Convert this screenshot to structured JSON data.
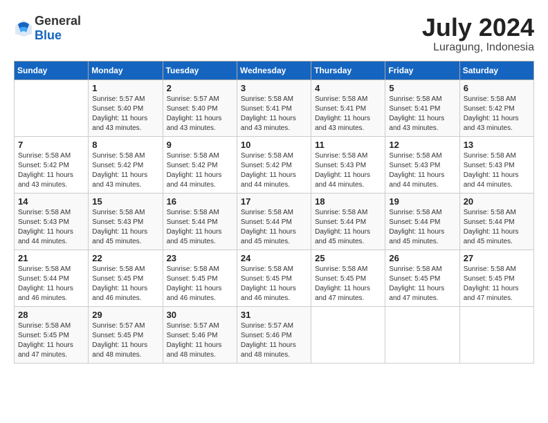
{
  "header": {
    "logo_general": "General",
    "logo_blue": "Blue",
    "month_year": "July 2024",
    "location": "Luragung, Indonesia"
  },
  "weekdays": [
    "Sunday",
    "Monday",
    "Tuesday",
    "Wednesday",
    "Thursday",
    "Friday",
    "Saturday"
  ],
  "weeks": [
    [
      {
        "day": "",
        "info": ""
      },
      {
        "day": "1",
        "info": "Sunrise: 5:57 AM\nSunset: 5:40 PM\nDaylight: 11 hours\nand 43 minutes."
      },
      {
        "day": "2",
        "info": "Sunrise: 5:57 AM\nSunset: 5:40 PM\nDaylight: 11 hours\nand 43 minutes."
      },
      {
        "day": "3",
        "info": "Sunrise: 5:58 AM\nSunset: 5:41 PM\nDaylight: 11 hours\nand 43 minutes."
      },
      {
        "day": "4",
        "info": "Sunrise: 5:58 AM\nSunset: 5:41 PM\nDaylight: 11 hours\nand 43 minutes."
      },
      {
        "day": "5",
        "info": "Sunrise: 5:58 AM\nSunset: 5:41 PM\nDaylight: 11 hours\nand 43 minutes."
      },
      {
        "day": "6",
        "info": "Sunrise: 5:58 AM\nSunset: 5:42 PM\nDaylight: 11 hours\nand 43 minutes."
      }
    ],
    [
      {
        "day": "7",
        "info": "Sunrise: 5:58 AM\nSunset: 5:42 PM\nDaylight: 11 hours\nand 43 minutes."
      },
      {
        "day": "8",
        "info": "Sunrise: 5:58 AM\nSunset: 5:42 PM\nDaylight: 11 hours\nand 43 minutes."
      },
      {
        "day": "9",
        "info": "Sunrise: 5:58 AM\nSunset: 5:42 PM\nDaylight: 11 hours\nand 44 minutes."
      },
      {
        "day": "10",
        "info": "Sunrise: 5:58 AM\nSunset: 5:42 PM\nDaylight: 11 hours\nand 44 minutes."
      },
      {
        "day": "11",
        "info": "Sunrise: 5:58 AM\nSunset: 5:43 PM\nDaylight: 11 hours\nand 44 minutes."
      },
      {
        "day": "12",
        "info": "Sunrise: 5:58 AM\nSunset: 5:43 PM\nDaylight: 11 hours\nand 44 minutes."
      },
      {
        "day": "13",
        "info": "Sunrise: 5:58 AM\nSunset: 5:43 PM\nDaylight: 11 hours\nand 44 minutes."
      }
    ],
    [
      {
        "day": "14",
        "info": "Sunrise: 5:58 AM\nSunset: 5:43 PM\nDaylight: 11 hours\nand 44 minutes."
      },
      {
        "day": "15",
        "info": "Sunrise: 5:58 AM\nSunset: 5:43 PM\nDaylight: 11 hours\nand 45 minutes."
      },
      {
        "day": "16",
        "info": "Sunrise: 5:58 AM\nSunset: 5:44 PM\nDaylight: 11 hours\nand 45 minutes."
      },
      {
        "day": "17",
        "info": "Sunrise: 5:58 AM\nSunset: 5:44 PM\nDaylight: 11 hours\nand 45 minutes."
      },
      {
        "day": "18",
        "info": "Sunrise: 5:58 AM\nSunset: 5:44 PM\nDaylight: 11 hours\nand 45 minutes."
      },
      {
        "day": "19",
        "info": "Sunrise: 5:58 AM\nSunset: 5:44 PM\nDaylight: 11 hours\nand 45 minutes."
      },
      {
        "day": "20",
        "info": "Sunrise: 5:58 AM\nSunset: 5:44 PM\nDaylight: 11 hours\nand 45 minutes."
      }
    ],
    [
      {
        "day": "21",
        "info": "Sunrise: 5:58 AM\nSunset: 5:44 PM\nDaylight: 11 hours\nand 46 minutes."
      },
      {
        "day": "22",
        "info": "Sunrise: 5:58 AM\nSunset: 5:45 PM\nDaylight: 11 hours\nand 46 minutes."
      },
      {
        "day": "23",
        "info": "Sunrise: 5:58 AM\nSunset: 5:45 PM\nDaylight: 11 hours\nand 46 minutes."
      },
      {
        "day": "24",
        "info": "Sunrise: 5:58 AM\nSunset: 5:45 PM\nDaylight: 11 hours\nand 46 minutes."
      },
      {
        "day": "25",
        "info": "Sunrise: 5:58 AM\nSunset: 5:45 PM\nDaylight: 11 hours\nand 47 minutes."
      },
      {
        "day": "26",
        "info": "Sunrise: 5:58 AM\nSunset: 5:45 PM\nDaylight: 11 hours\nand 47 minutes."
      },
      {
        "day": "27",
        "info": "Sunrise: 5:58 AM\nSunset: 5:45 PM\nDaylight: 11 hours\nand 47 minutes."
      }
    ],
    [
      {
        "day": "28",
        "info": "Sunrise: 5:58 AM\nSunset: 5:45 PM\nDaylight: 11 hours\nand 47 minutes."
      },
      {
        "day": "29",
        "info": "Sunrise: 5:57 AM\nSunset: 5:45 PM\nDaylight: 11 hours\nand 48 minutes."
      },
      {
        "day": "30",
        "info": "Sunrise: 5:57 AM\nSunset: 5:46 PM\nDaylight: 11 hours\nand 48 minutes."
      },
      {
        "day": "31",
        "info": "Sunrise: 5:57 AM\nSunset: 5:46 PM\nDaylight: 11 hours\nand 48 minutes."
      },
      {
        "day": "",
        "info": ""
      },
      {
        "day": "",
        "info": ""
      },
      {
        "day": "",
        "info": ""
      }
    ]
  ]
}
